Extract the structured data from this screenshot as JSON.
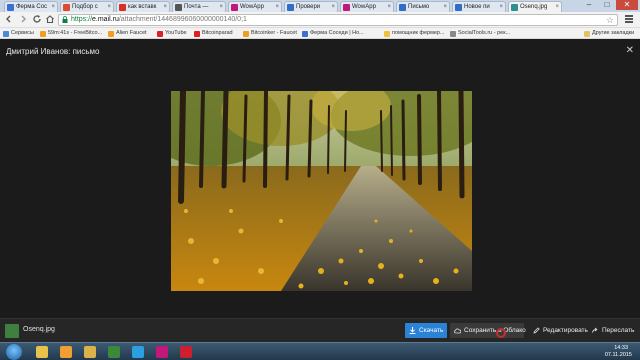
{
  "browser": {
    "tabs": [
      {
        "label": "Ферма Сос",
        "icon_color": "#3b6fd1"
      },
      {
        "label": "Подбор с",
        "icon_color": "#e04a2f"
      },
      {
        "label": "как вставк",
        "icon_color": "#d93025"
      },
      {
        "label": "Почта — ",
        "icon_color": "#555555"
      },
      {
        "label": "WowApp",
        "icon_color": "#c2187a"
      },
      {
        "label": "Провери",
        "icon_color": "#2f6ec8"
      },
      {
        "label": "WowApp",
        "icon_color": "#c2187a"
      },
      {
        "label": "Письмо ",
        "icon_color": "#2f6ec8"
      },
      {
        "label": "Новое пи",
        "icon_color": "#2f6ec8"
      },
      {
        "label": "Osenq.jpg",
        "icon_color": "#2f8f8f",
        "active": true
      }
    ],
    "window_buttons": {
      "minimize": "–",
      "maximize": "□",
      "close": "✕"
    },
    "address": {
      "protocol": "https://",
      "host": "e.mail.ru",
      "path": "/attachment/14468996060000000140/0;1"
    },
    "bookmarks": [
      {
        "label": "Сервисы",
        "icon_color": "#4a8ad8"
      },
      {
        "label": "59m:41s - FreeBitco...",
        "icon_color": "#f0a020"
      },
      {
        "label": "Alien Faucet",
        "icon_color": "#f0a020"
      },
      {
        "label": "YouTube",
        "icon_color": "#e02020"
      },
      {
        "label": "Bitcoinparad",
        "icon_color": "#e02020"
      },
      {
        "label": "Bitcoinker - Faucet",
        "icon_color": "#f0a020"
      },
      {
        "label": "Ферма Соседи | Но...",
        "icon_color": "#3b6fd1"
      },
      {
        "label": "помощник фермер...",
        "icon_color": "#f0c040"
      },
      {
        "label": "SocialTools.ru - рек...",
        "icon_color": "#888888"
      }
    ],
    "other_bookmarks": "Другие закладки"
  },
  "viewer": {
    "title": "Дмитрий Иванов: письмо",
    "close_glyph": "✕",
    "photo_alt": "Осенний парк"
  },
  "bottom_bar": {
    "file_name": "Osenq.jpg",
    "download_label": "Скачать",
    "save_cloud_label": "Сохранить в Облако",
    "edit_label": "Редактировать",
    "forward_label": "Переслать"
  },
  "taskbar": {
    "apps": [
      {
        "name": "explorer",
        "color": "#e8c24a"
      },
      {
        "name": "media",
        "color": "#f0a030"
      },
      {
        "name": "folder",
        "color": "#d9b24b"
      },
      {
        "name": "chrome",
        "color": "#3a8a3a"
      },
      {
        "name": "skype",
        "color": "#2aa0e0"
      },
      {
        "name": "wowapp",
        "color": "#c2187a"
      },
      {
        "name": "opera",
        "color": "#cc1f2f"
      }
    ],
    "time": "14:33",
    "date": "07.11.2015"
  }
}
